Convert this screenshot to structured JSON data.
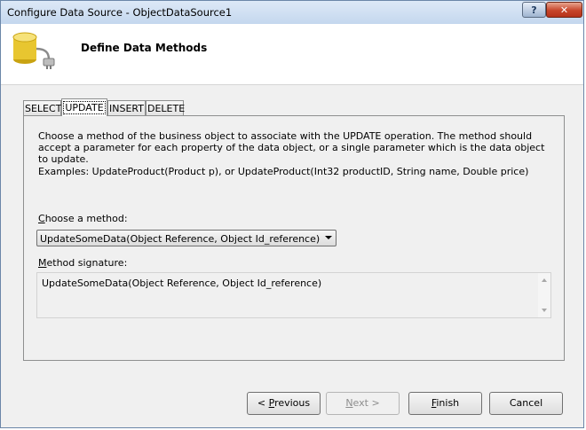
{
  "window": {
    "title": "Configure Data Source - ObjectDataSource1",
    "help_label": "?",
    "close_label": "✕"
  },
  "header": {
    "title": "Define Data Methods",
    "icon": "database-connect-icon"
  },
  "tabs": [
    {
      "label": "SELECT",
      "active": false
    },
    {
      "label": "UPDATE",
      "active": true
    },
    {
      "label": "INSERT",
      "active": false
    },
    {
      "label": "DELETE",
      "active": false
    }
  ],
  "panel": {
    "description": "Choose a method of the business object to associate with the UPDATE operation. The method should accept a parameter for each property of the data object, or a single parameter which is the data object to update.",
    "examples": "Examples: UpdateProduct(Product p), or UpdateProduct(Int32 productID, String name, Double price)",
    "choose_label_key": "C",
    "choose_label_rest": "hoose a method:",
    "selected_method": "UpdateSomeData(Object Reference, Object Id_reference)",
    "signature_label_key": "M",
    "signature_label_rest": "ethod signature:",
    "signature": "UpdateSomeData(Object Reference, Object Id_reference)"
  },
  "footer": {
    "previous_lead": "< ",
    "previous_key": "P",
    "previous_rest": "revious",
    "next_key": "N",
    "next_rest": "ext >",
    "finish_key": "F",
    "finish_rest": "inish",
    "cancel_label": "Cancel"
  },
  "colors": {
    "titlebar": "#c4d7ee",
    "close_button": "#c7452a",
    "dialog_bg": "#f0f0f0",
    "database_icon": "#e8c630"
  }
}
